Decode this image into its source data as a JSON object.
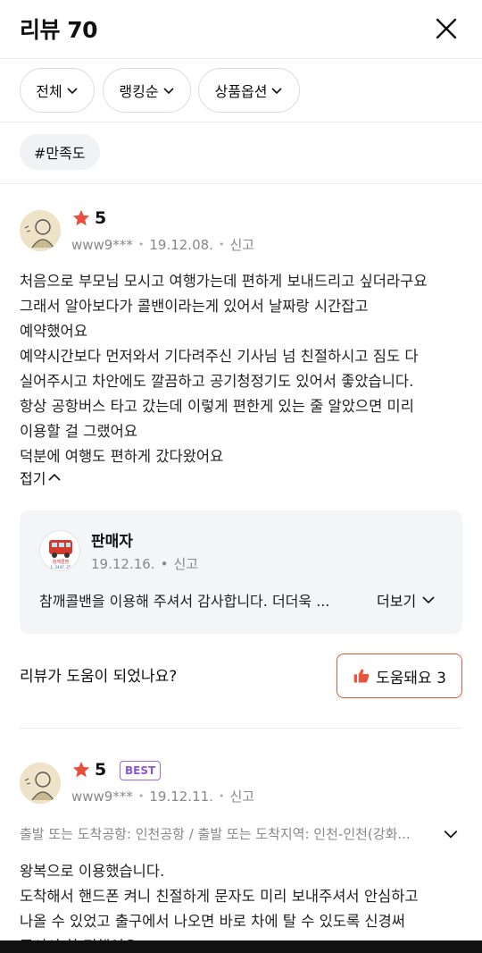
{
  "header": {
    "title": "리뷰 70"
  },
  "filters": {
    "all": "전체",
    "sort": "랭킹순",
    "option": "상품옵션"
  },
  "tag": "#만족도",
  "review1": {
    "rating": "5",
    "user": "www9***",
    "date": "19.12.08.",
    "report": "신고",
    "lines": [
      "처음으로 부모님 모시고 여행가는데 편하게 보내드리고 싶더라구요",
      "그래서 알아보다가 콜밴이라는게 있어서 날짜랑 시간잡고",
      "예약했어요",
      "예약시간보다 먼저와서 기다려주신 기사님 넘 친절하시고 짐도 다",
      "실어주시고 차안에도 깔끔하고 공기청정기도 있어서 좋았습니다.",
      "항상 공항버스 타고 갔는데 이렇게 편한게 있는 줄 알았으면 미리",
      "이용할 걸 그랬어요",
      "덕분에 여행도 편하게 갔다왔어요"
    ],
    "fold": "접기",
    "seller": {
      "name": "판매자",
      "date": "19.12.16.",
      "report": "신고",
      "reply": "참깨콜밴을 이용해 주셔서 감사합니다. 더더욱 ...",
      "more": "더보기",
      "logo_text": "참깨콜밴",
      "logo_phone": "1. 2447. 25"
    },
    "helpful_question": "리뷰가 도움이 되었나요?",
    "helpful_button": "도움돼요 3"
  },
  "review2": {
    "rating": "5",
    "badge": "BEST",
    "user": "www9***",
    "date": "19.12.11.",
    "report": "신고",
    "option": "출발 또는 도착공항: 인천공항 / 출발 또는 도착지역: 인천-인천(강화...",
    "lines": [
      "왕복으로 이용했습니다.",
      "도착해서 핸드폰 켜니 친절하게 문자도 미리 보내주셔서 안심하고",
      "나올 수 있었고 출구에서 나오면 바로 차에 탈 수 있도록 신경써",
      "주셔서 참 편했어요"
    ]
  },
  "colors": {
    "accent": "#e8543e",
    "star": "#ea4e3d",
    "best": "#8a55d6"
  },
  "icons": [
    "close-icon",
    "chevron-down-icon",
    "chevron-up-icon",
    "star-icon",
    "thumbs-up-icon"
  ]
}
